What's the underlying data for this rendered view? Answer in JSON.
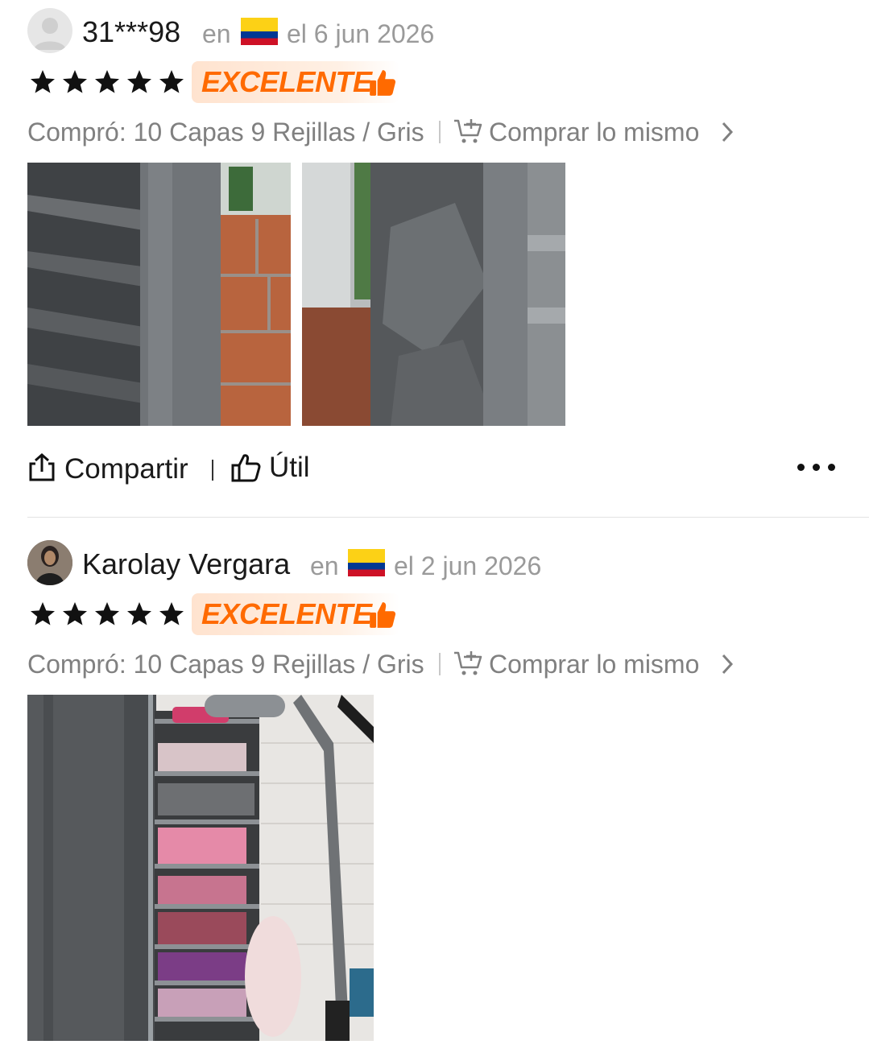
{
  "reviews": [
    {
      "author": "31***98",
      "location_prefix": "en",
      "country_flag": "colombia-flag-icon",
      "date": "el 6 jun 2026",
      "rating": 5,
      "rating_label": "EXCELENTE",
      "purchased": "Compró: 10 Capas 9 Rejillas / Gris",
      "buy_same_label": "Comprar lo mismo",
      "photos_count": 2,
      "share_label": "Compartir",
      "helpful_label": "Útil"
    },
    {
      "author": "Karolay Vergara",
      "location_prefix": "en",
      "country_flag": "colombia-flag-icon",
      "date": "el 2 jun 2026",
      "rating": 5,
      "rating_label": "EXCELENTE",
      "purchased": "Compró: 10 Capas 9 Rejillas / Gris",
      "buy_same_label": "Comprar lo mismo",
      "photos_count": 1
    }
  ],
  "colors": {
    "accent": "#ff6a00",
    "badge_bg": "#ffe3cf",
    "muted_text": "#808080",
    "stars": "#111111"
  }
}
